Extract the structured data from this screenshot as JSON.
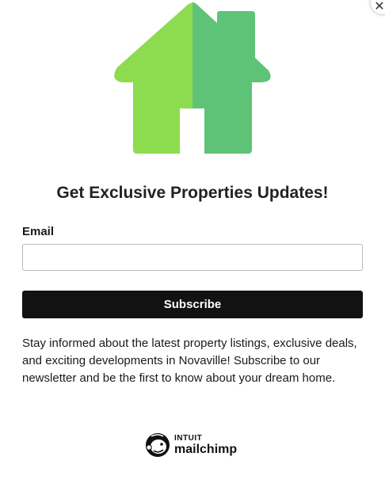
{
  "popup": {
    "close_glyph": "✕",
    "title": "Get Exclusive Properties Updates!",
    "email_label": "Email",
    "email_value": "",
    "email_placeholder": "",
    "subscribe_label": "Subscribe",
    "description": "Stay informed about the latest property listings, exclusive deals, and exciting developments in Novaville! Subscribe to our newsletter and be the first to know about your dream home.",
    "hero_icon": "house-icon",
    "colors": {
      "house_left": "#8ddc50",
      "house_right": "#5ec376",
      "button_bg": "#121212",
      "button_text": "#ffffff"
    }
  },
  "branding": {
    "logo_icon": "mailchimp-freddie-icon",
    "top_text": "INTUIT",
    "bottom_text": "mailchimp"
  }
}
